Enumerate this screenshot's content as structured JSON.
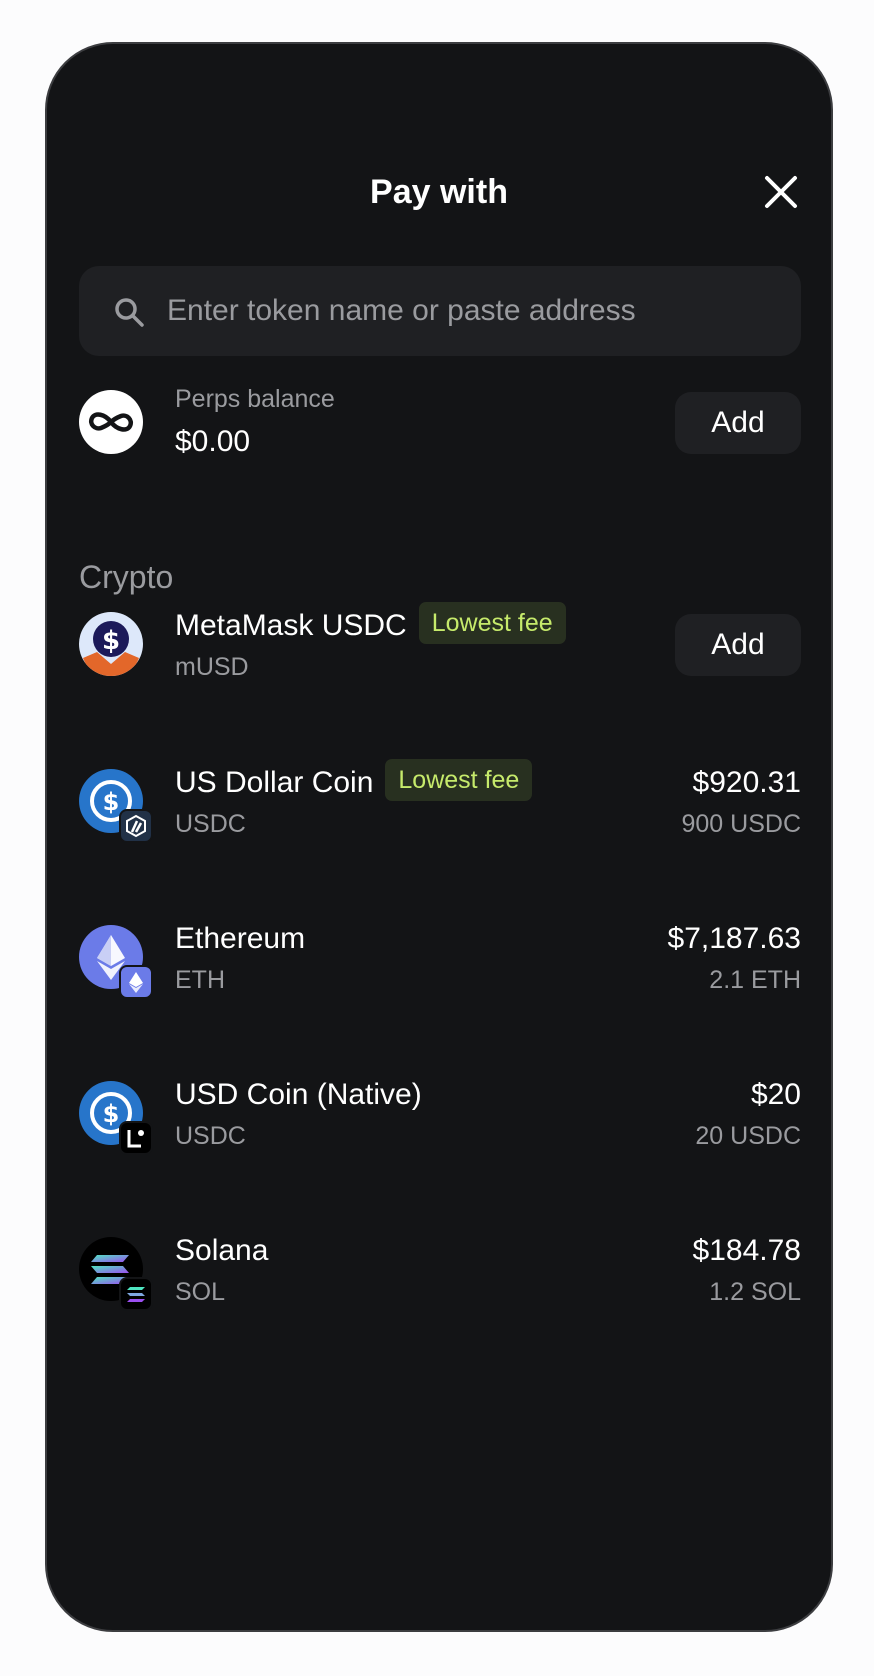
{
  "header": {
    "title": "Pay with"
  },
  "search": {
    "placeholder": "Enter token name or paste address",
    "value": ""
  },
  "perps": {
    "label": "Perps balance",
    "value": "$0.00",
    "button_label": "Add"
  },
  "crypto": {
    "section_title": "Crypto",
    "items": [
      {
        "name": "MetaMask USDC",
        "symbol": "mUSD",
        "tag": "Lowest fee",
        "button_label": "Add"
      },
      {
        "name": "US Dollar Coin",
        "symbol": "USDC",
        "tag": "Lowest fee",
        "value": "$920.31",
        "amount": "900 USDC",
        "network": "arbitrum"
      },
      {
        "name": "Ethereum",
        "symbol": "ETH",
        "value": "$7,187.63",
        "amount": "2.1 ETH",
        "network": "ethereum"
      },
      {
        "name": "USD Coin (Native)",
        "symbol": "USDC",
        "value": "$20",
        "amount": "20 USDC",
        "network": "linea"
      },
      {
        "name": "Solana",
        "symbol": "SOL",
        "value": "$184.78",
        "amount": "1.2 SOL",
        "network": "solana"
      }
    ]
  },
  "colors": {
    "background": "#131416",
    "surface": "#1f2023",
    "text_primary": "#ffffff",
    "text_secondary": "#9a9b9f",
    "fee_badge_bg": "#283020",
    "fee_badge_text": "#c6ea6b",
    "usdc_blue": "#2775ca",
    "eth_purple": "#6b7be8"
  }
}
